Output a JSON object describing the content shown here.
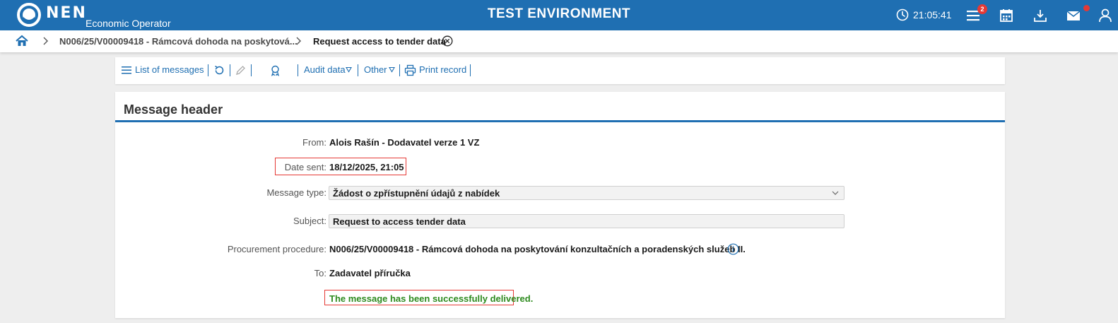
{
  "topbar": {
    "logo": "NEN",
    "subtitle": "Economic Operator",
    "environment": "TEST ENVIRONMENT",
    "clock": "21:05:41",
    "menu_badge": "2",
    "icons": [
      "clock-icon",
      "menu-icon",
      "calendar-icon",
      "download-icon",
      "mail-icon",
      "user-icon"
    ],
    "accent": "#1f6fb2"
  },
  "breadcrumb": {
    "items": [
      "N006/25/V00009418 - Rámcová dohoda na poskytová...",
      "Request access to tender data"
    ]
  },
  "toolbar": {
    "list_of_messages": "List of messages",
    "audit_data": "Audit data",
    "other": "Other",
    "print_record": "Print record"
  },
  "message_header": {
    "title": "Message header",
    "from_label": "From:",
    "from_value": "Alois Rašín - Dodavatel verze 1 VZ",
    "date_label": "Date sent:",
    "date_value": "18/12/2025, 21:05",
    "type_label": "Message type:",
    "type_value": "Žádost o zpřístupnění údajů z nabídek",
    "subject_label": "Subject:",
    "subject_value": "Request to access tender data",
    "procedure_label": "Procurement procedure:",
    "procedure_value": "N006/25/V00009418 - Rámcová dohoda na poskytování konzultačních a poradenských služeb II.",
    "to_label": "To:",
    "to_value": "Zadavatel příručka",
    "status": "The message has been successfully delivered.",
    "status_color": "#2e8b1f",
    "highlight_color": "#e53935"
  }
}
